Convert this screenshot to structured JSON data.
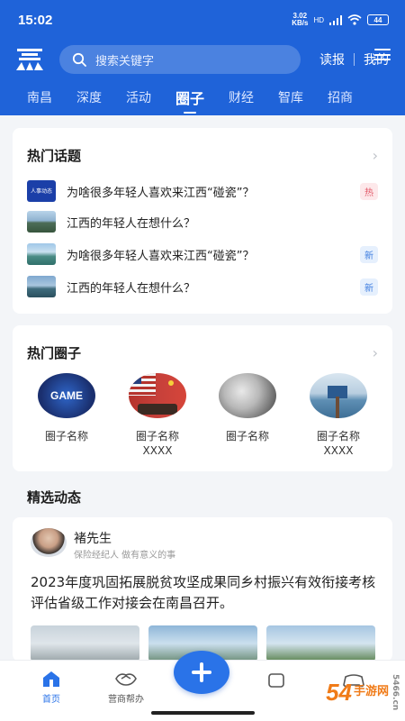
{
  "status": {
    "time": "15:02",
    "net_speed": "3.02",
    "net_unit": "KB/s",
    "network": "HD",
    "battery": "44"
  },
  "header": {
    "logo": "赣",
    "search_placeholder": "搜索关键字",
    "links": [
      "读报",
      "我的"
    ],
    "tabs": [
      "南昌",
      "深度",
      "活动",
      "圈子",
      "财经",
      "智库",
      "招商"
    ],
    "active_tab": "圈子"
  },
  "hot_topics": {
    "title": "热门话题",
    "items": [
      {
        "text": "为啥很多年轻人喜欢来江西“碰瓷”？",
        "badge": "热",
        "thumb_text": "人事动态"
      },
      {
        "text": "江西的年轻人在想什么？",
        "badge": ""
      },
      {
        "text": "为啥很多年轻人喜欢来江西“碰瓷”？",
        "badge": "新"
      },
      {
        "text": "江西的年轻人在想什么？",
        "badge": "新"
      }
    ]
  },
  "hot_circles": {
    "title": "热门圈子",
    "items": [
      {
        "name": "圈子名称",
        "name2": "",
        "image_text": "GAME"
      },
      {
        "name": "圈子名称",
        "name2": "XXXX"
      },
      {
        "name": "圈子名称",
        "name2": ""
      },
      {
        "name": "圈子名称",
        "name2": "XXXX"
      }
    ]
  },
  "featured": {
    "title": "精选动态",
    "post": {
      "author": "褚先生",
      "subtitle": "保险经纪人 做有意义的事",
      "body": "2023年度巩固拓展脱贫攻坚成果同乡村振兴有效衔接考核评估省级工作对接会在南昌召开。"
    }
  },
  "bottom_nav": [
    "首页",
    "营商帮办"
  ],
  "colors": {
    "brand": "#1f63d9",
    "fab": "#2a73e8",
    "hot_badge": "#e25b6a",
    "new_badge": "#3f7ee0"
  },
  "watermark": {
    "big": "54",
    "text1": "手游网",
    "url": "5466.cn"
  }
}
